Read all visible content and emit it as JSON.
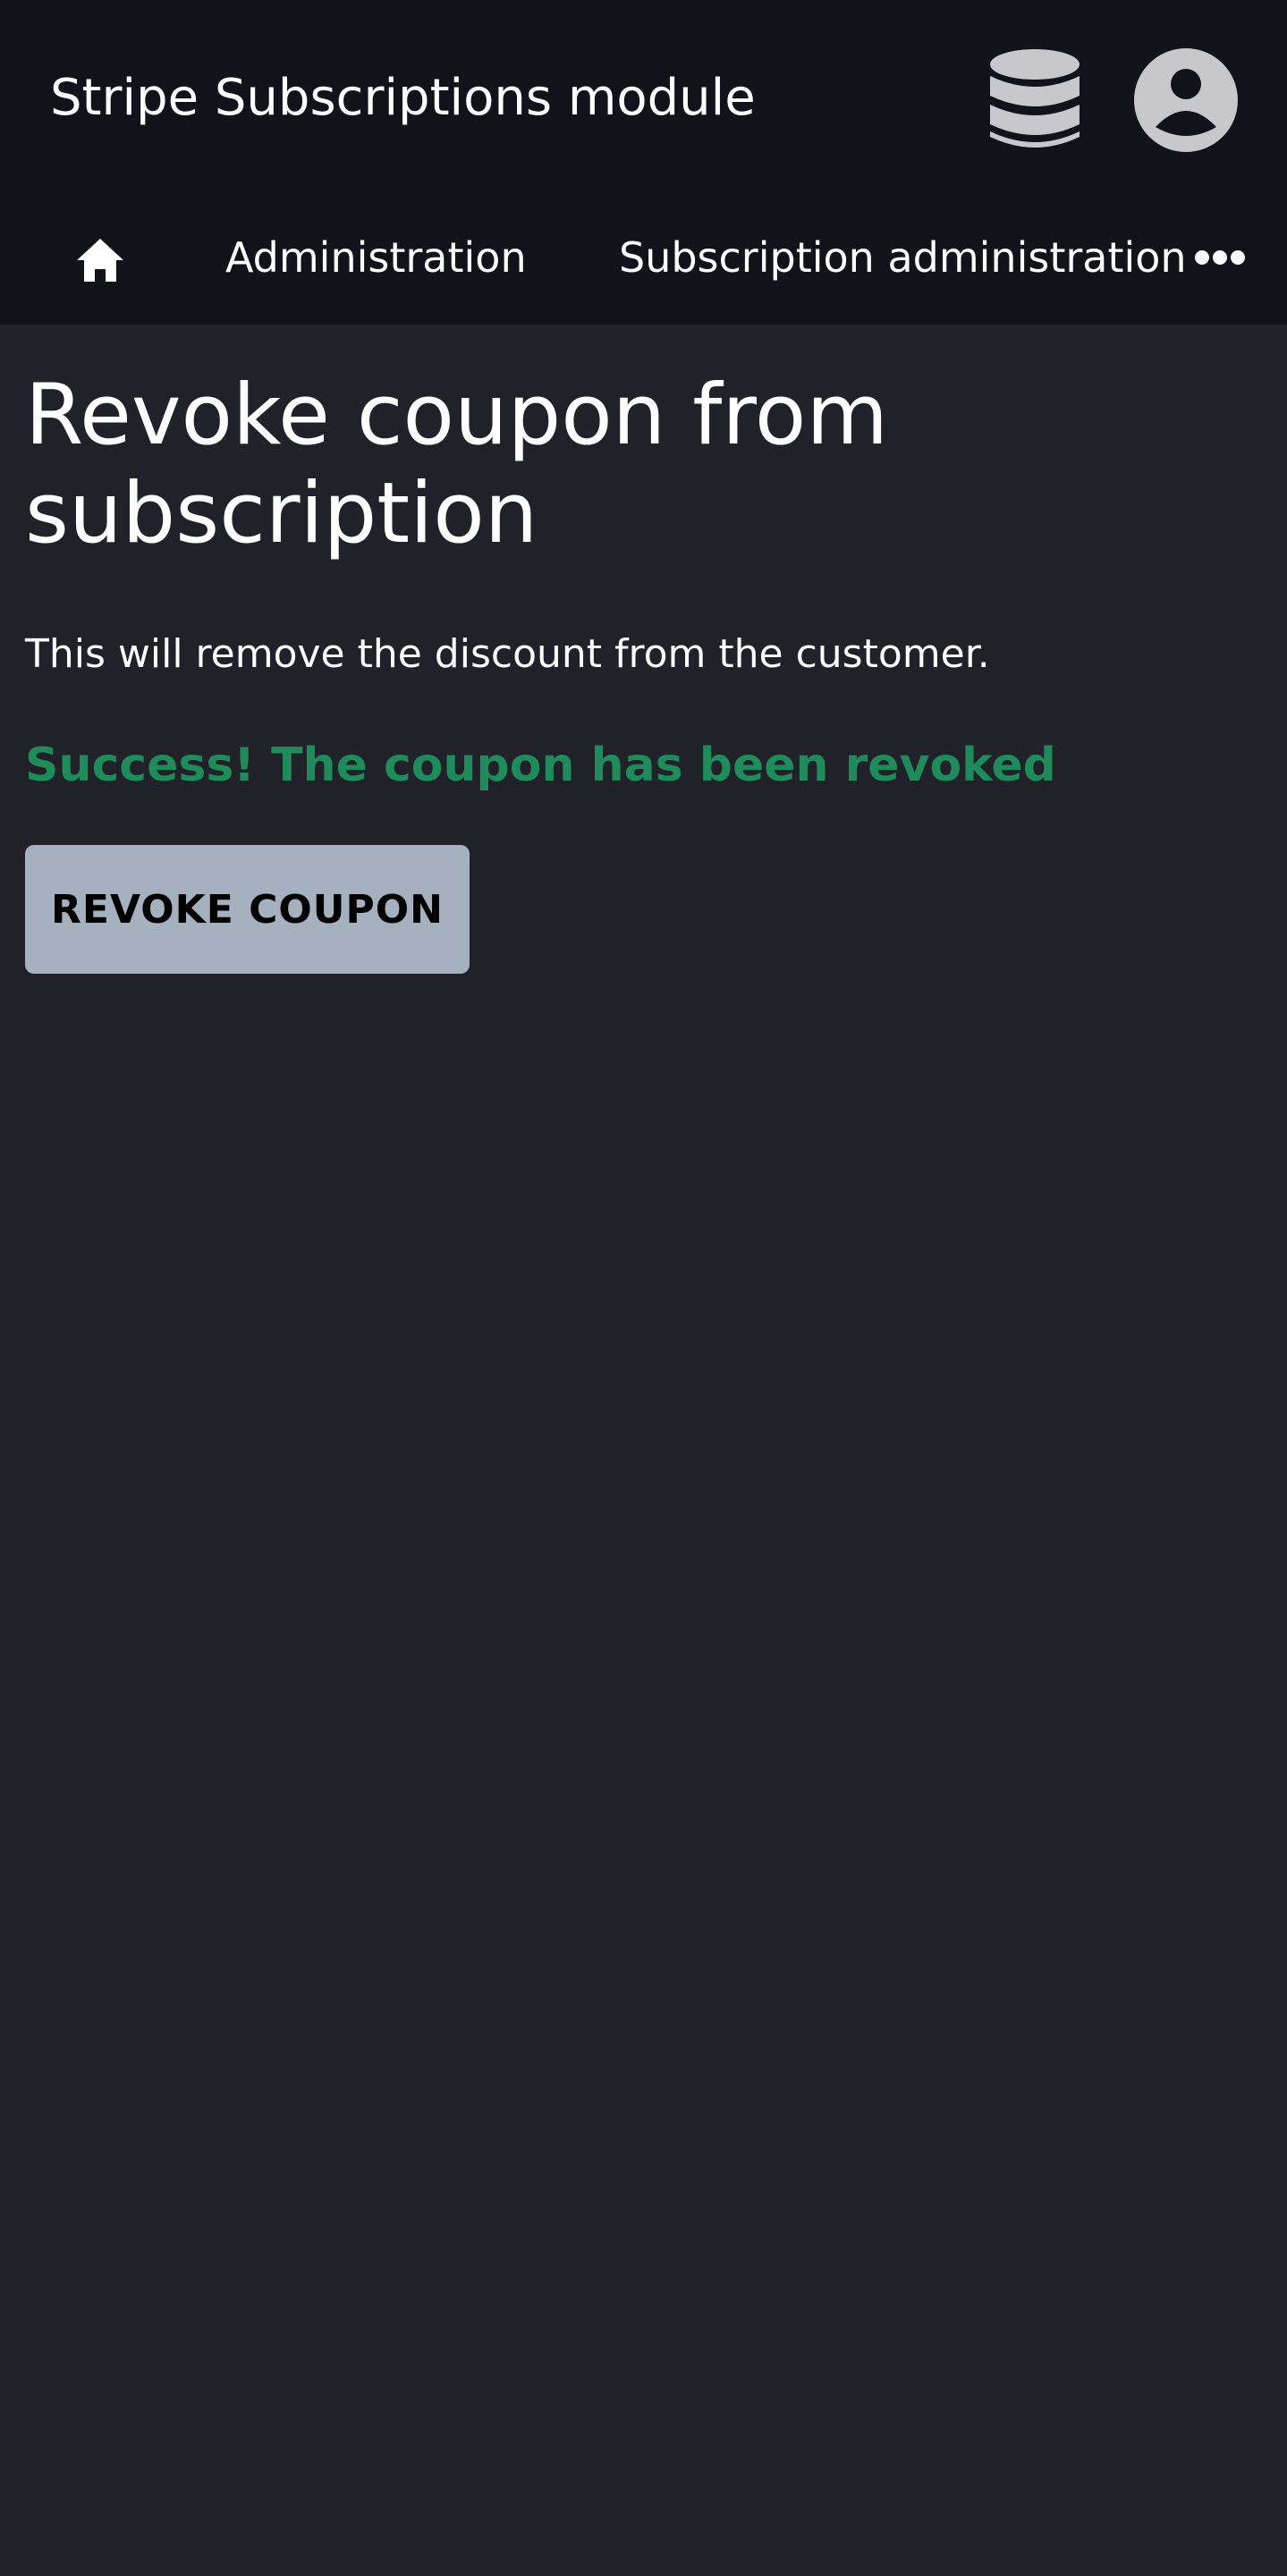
{
  "header": {
    "title": "Stripe Subscriptions module",
    "icons": [
      "database-icon",
      "user-avatar-icon"
    ]
  },
  "nav": {
    "home_icon": "home-icon",
    "items": [
      {
        "label": "Administration"
      },
      {
        "label": "Subscription administration"
      }
    ],
    "more_icon": "more-dots-icon"
  },
  "main": {
    "title": "Revoke coupon from subscription",
    "description": "This will remove the discount from the customer.",
    "success_message": "Success! The coupon has been revoked",
    "revoke_button_label": "REVOKE COUPON"
  },
  "colors": {
    "background": "#21212a",
    "header_background": "#12121b",
    "success": "#1f8a5a",
    "button": "#a5b1bf",
    "icon": "#c8c8cc"
  }
}
